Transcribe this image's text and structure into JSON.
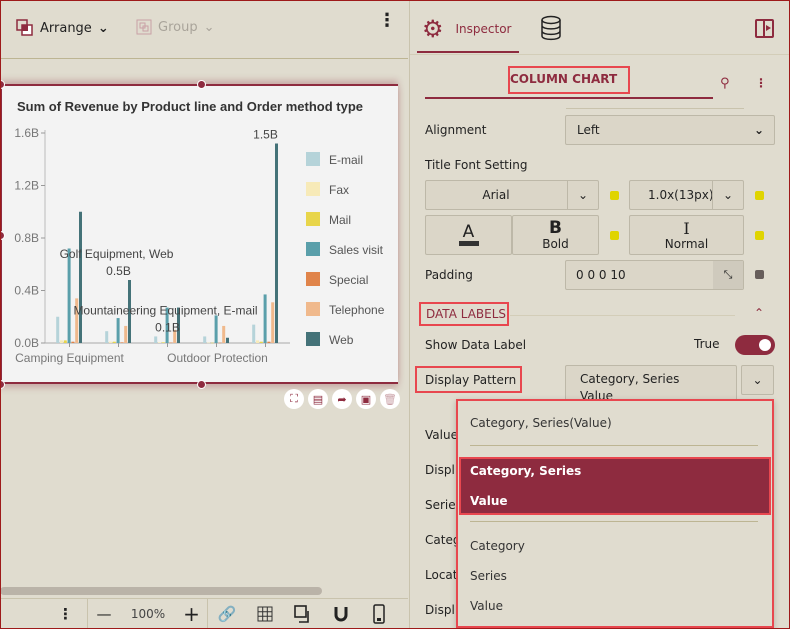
{
  "toolbar": {
    "arrange_label": "Arrange",
    "group_label": "Group"
  },
  "chart_data": {
    "type": "bar",
    "title": "Sum of Revenue by Product line and Order method type",
    "categories": [
      "Camping Equipment",
      "Golf Equipment",
      "Mountaineering Equipment",
      "Outdoor Protection",
      ""
    ],
    "x_tick_labels": [
      "Camping Equipment",
      "Outdoor Protection"
    ],
    "y_ticks": [
      "0.0B",
      "0.4B",
      "0.8B",
      "1.2B",
      "1.6B"
    ],
    "ylim": [
      0,
      1.6
    ],
    "yunit": "B",
    "legend_position": "right",
    "series": [
      {
        "name": "E-mail",
        "color": "#b5d3d9",
        "values": [
          0.2,
          0.09,
          0.05,
          0.05,
          0.14
        ]
      },
      {
        "name": "Fax",
        "color": "#f7eab8",
        "values": [
          0.02,
          0.01,
          0.005,
          0.003,
          0.02
        ]
      },
      {
        "name": "Mail",
        "color": "#e8d54a",
        "values": [
          0.02,
          0.01,
          0.005,
          0.002,
          0.01
        ]
      },
      {
        "name": "Sales visit",
        "color": "#5a9faa",
        "values": [
          0.72,
          0.19,
          0.27,
          0.21,
          0.37
        ]
      },
      {
        "name": "Special",
        "color": "#e0844a",
        "values": [
          0.01,
          0.005,
          0.003,
          0.002,
          0.01
        ]
      },
      {
        "name": "Telephone",
        "color": "#f0b98c",
        "values": [
          0.34,
          0.13,
          0.1,
          0.13,
          0.31
        ]
      },
      {
        "name": "Web",
        "color": "#447278",
        "values": [
          1.0,
          0.48,
          0.27,
          0.04,
          1.52
        ]
      }
    ],
    "data_labels": [
      {
        "text": "Golf Equipment, Web",
        "value": "0.5B"
      },
      {
        "text": "Mountaineering Equipment, E-mail",
        "value": "0.1B"
      },
      {
        "text": "",
        "value": "1.5B"
      }
    ]
  },
  "bottom": {
    "zoom": "100%"
  },
  "inspector": {
    "tab_label": "Inspector",
    "section_title": "COLUMN CHART",
    "alignment_label": "Alignment",
    "alignment_value": "Left",
    "title_font_label": "Title Font Setting",
    "font_family": "Arial",
    "font_size": "1.0x(13px)",
    "font_color_glyph": "A",
    "bold_glyph": "B",
    "bold_label": "Bold",
    "italic_glyph": "I",
    "italic_label": "Normal",
    "padding_label": "Padding",
    "padding_value": "0 0 0 10",
    "data_labels_header": "DATA LABELS",
    "show_data_label": "Show Data Label",
    "show_data_label_value": "True",
    "display_pattern_label": "Display Pattern",
    "display_pattern_value": "Category, Series",
    "display_pattern_value2": "Value",
    "hidden_rows": [
      "Value",
      "Displ",
      "Serie",
      "Categ",
      "Locat",
      "Displ"
    ],
    "accent": "#8e2b3f"
  },
  "dropdown": {
    "options": [
      "Category, Series(Value)",
      "Category, Series",
      "Value",
      "Category",
      "Series",
      "Value"
    ]
  }
}
